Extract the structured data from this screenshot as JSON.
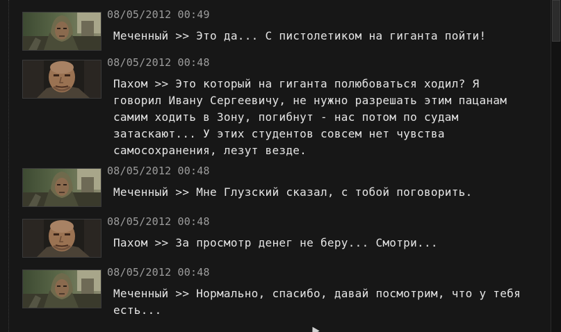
{
  "log": {
    "entries": [
      {
        "speaker": "marked-one",
        "portrait_icon": "stalker-hooded-portrait-icon",
        "timestamp": "08/05/2012 00:49",
        "message": "Меченный >> Это да... С пистолетиком на гиганта пойти!"
      },
      {
        "speaker": "pakhom",
        "portrait_icon": "stalker-bald-portrait-icon",
        "timestamp": "08/05/2012 00:48",
        "message": "Пахом >> Это который на гиганта полюбоваться ходил? Я говорил Ивану Сергеевичу, не нужно разрешать этим пацанам самим ходить в Зону, погибнут - нас потом по судам затаскают... У этих студентов совсем нет чувства самосохранения, лезут везде."
      },
      {
        "speaker": "marked-one",
        "portrait_icon": "stalker-hooded-portrait-icon",
        "timestamp": "08/05/2012 00:48",
        "message": "Меченный >> Мне Глузский сказал, с тобой поговорить."
      },
      {
        "speaker": "pakhom",
        "portrait_icon": "stalker-bald-portrait-icon",
        "timestamp": "08/05/2012 00:48",
        "message": "Пахом >> За просмотр денег не беру... Смотри..."
      },
      {
        "speaker": "marked-one",
        "portrait_icon": "stalker-hooded-portrait-icon",
        "timestamp": "08/05/2012 00:48",
        "message": "Меченный >> Нормально, спасибо, давай посмотрим, что у тебя есть..."
      }
    ]
  },
  "colors": {
    "background": "#171717",
    "timestamp_text": "#9d9d9d",
    "message_text": "#e6e6e6"
  }
}
